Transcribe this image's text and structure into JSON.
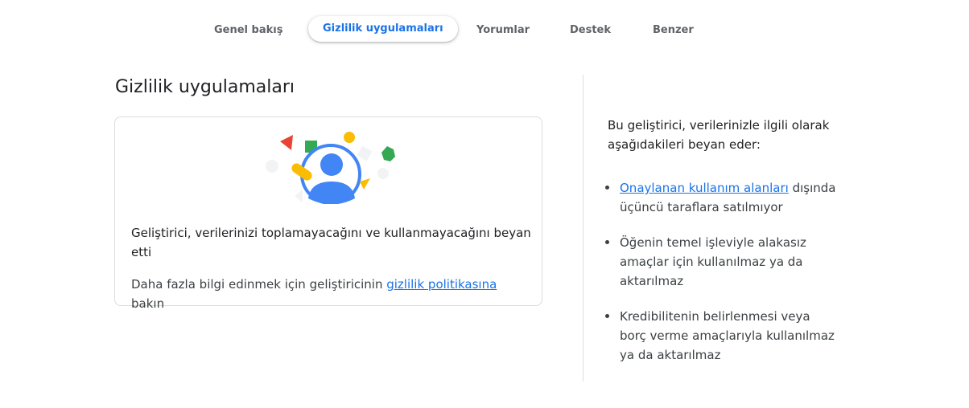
{
  "tabs": [
    {
      "label": "Genel bakış"
    },
    {
      "label": "Gizlilik uygulamaları"
    },
    {
      "label": "Yorumlar"
    },
    {
      "label": "Destek"
    },
    {
      "label": "Benzer"
    }
  ],
  "active_tab": "Gizlilik uygulamaları",
  "section": {
    "title": "Gizlilik uygulamaları"
  },
  "card": {
    "illustration": "privacy-user-icon",
    "statement": "Geliştirici, verilerinizi toplamayacağını ve kullanmayacağını beyan etti",
    "more_prefix": "Daha fazla bilgi edinmek için geliştiricinin",
    "more_link": "gizlilik politikasına",
    "more_suffix": "bakın"
  },
  "sidebar": {
    "intro": "Bu geliştirici, verilerinizle ilgili olarak aşağıdakileri beyan eder:",
    "items": [
      {
        "link": "Onaylanan kullanım alanları",
        "text": "dışında üçüncü taraflara satılmıyor"
      },
      {
        "text": "Öğenin temel işleviyle alakasız amaçlar için kullanılmaz ya da aktarılmaz"
      },
      {
        "text": "Kredibilitenin belirlenmesi veya borç verme amaçlarıyla kullanılmaz ya da aktarılmaz"
      }
    ]
  },
  "colors": {
    "accent": "#1a73e8",
    "text": "#202124",
    "border": "#dadce0"
  }
}
